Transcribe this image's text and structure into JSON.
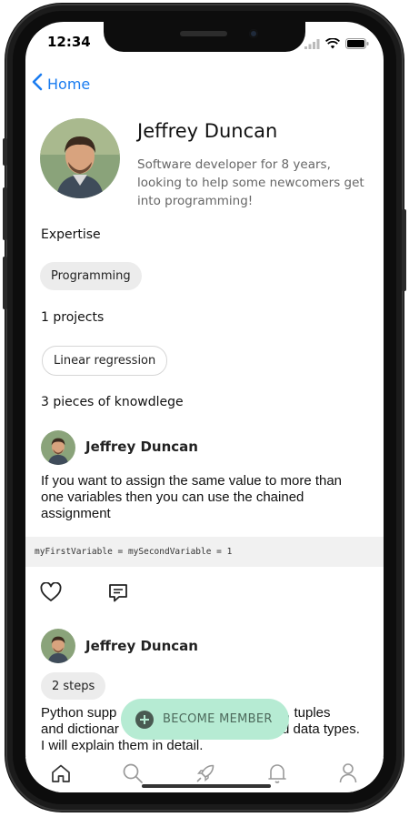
{
  "status_bar": {
    "time": "12:34"
  },
  "nav": {
    "back_label": "Home"
  },
  "profile": {
    "name": "Jeffrey Duncan",
    "bio": "Software developer for 8 years, looking to help some newcomers get into programming!"
  },
  "expertise": {
    "label": "Expertise",
    "chips": [
      "Programming"
    ]
  },
  "projects": {
    "label": "1 projects",
    "chips": [
      "Linear regression"
    ]
  },
  "knowledge": {
    "label": "3 pieces of knowdlege"
  },
  "posts": [
    {
      "author": "Jeffrey Duncan",
      "text": "If you want to assign the same value to more than one variables then you can use the chained assignment",
      "code": "myFirstVariable = mySecondVariable = 1"
    },
    {
      "author": "Jeffrey Duncan",
      "badge": "2 steps",
      "text_line1": "Python supp",
      "text_line1_end": ", lists, tuples",
      "text_line2": "and dictionar",
      "text_line2_end": "d data types.",
      "text_line3": "I will explain them in detail."
    }
  ],
  "fab": {
    "label": "BECOME MEMBER"
  },
  "tabbar": {
    "items": [
      "home-icon",
      "search-icon",
      "rocket-icon",
      "bell-icon",
      "profile-icon"
    ]
  },
  "colors": {
    "accent": "#1a7cf0",
    "fab_bg": "#b6ebd3",
    "chip_bg": "#ececec"
  }
}
